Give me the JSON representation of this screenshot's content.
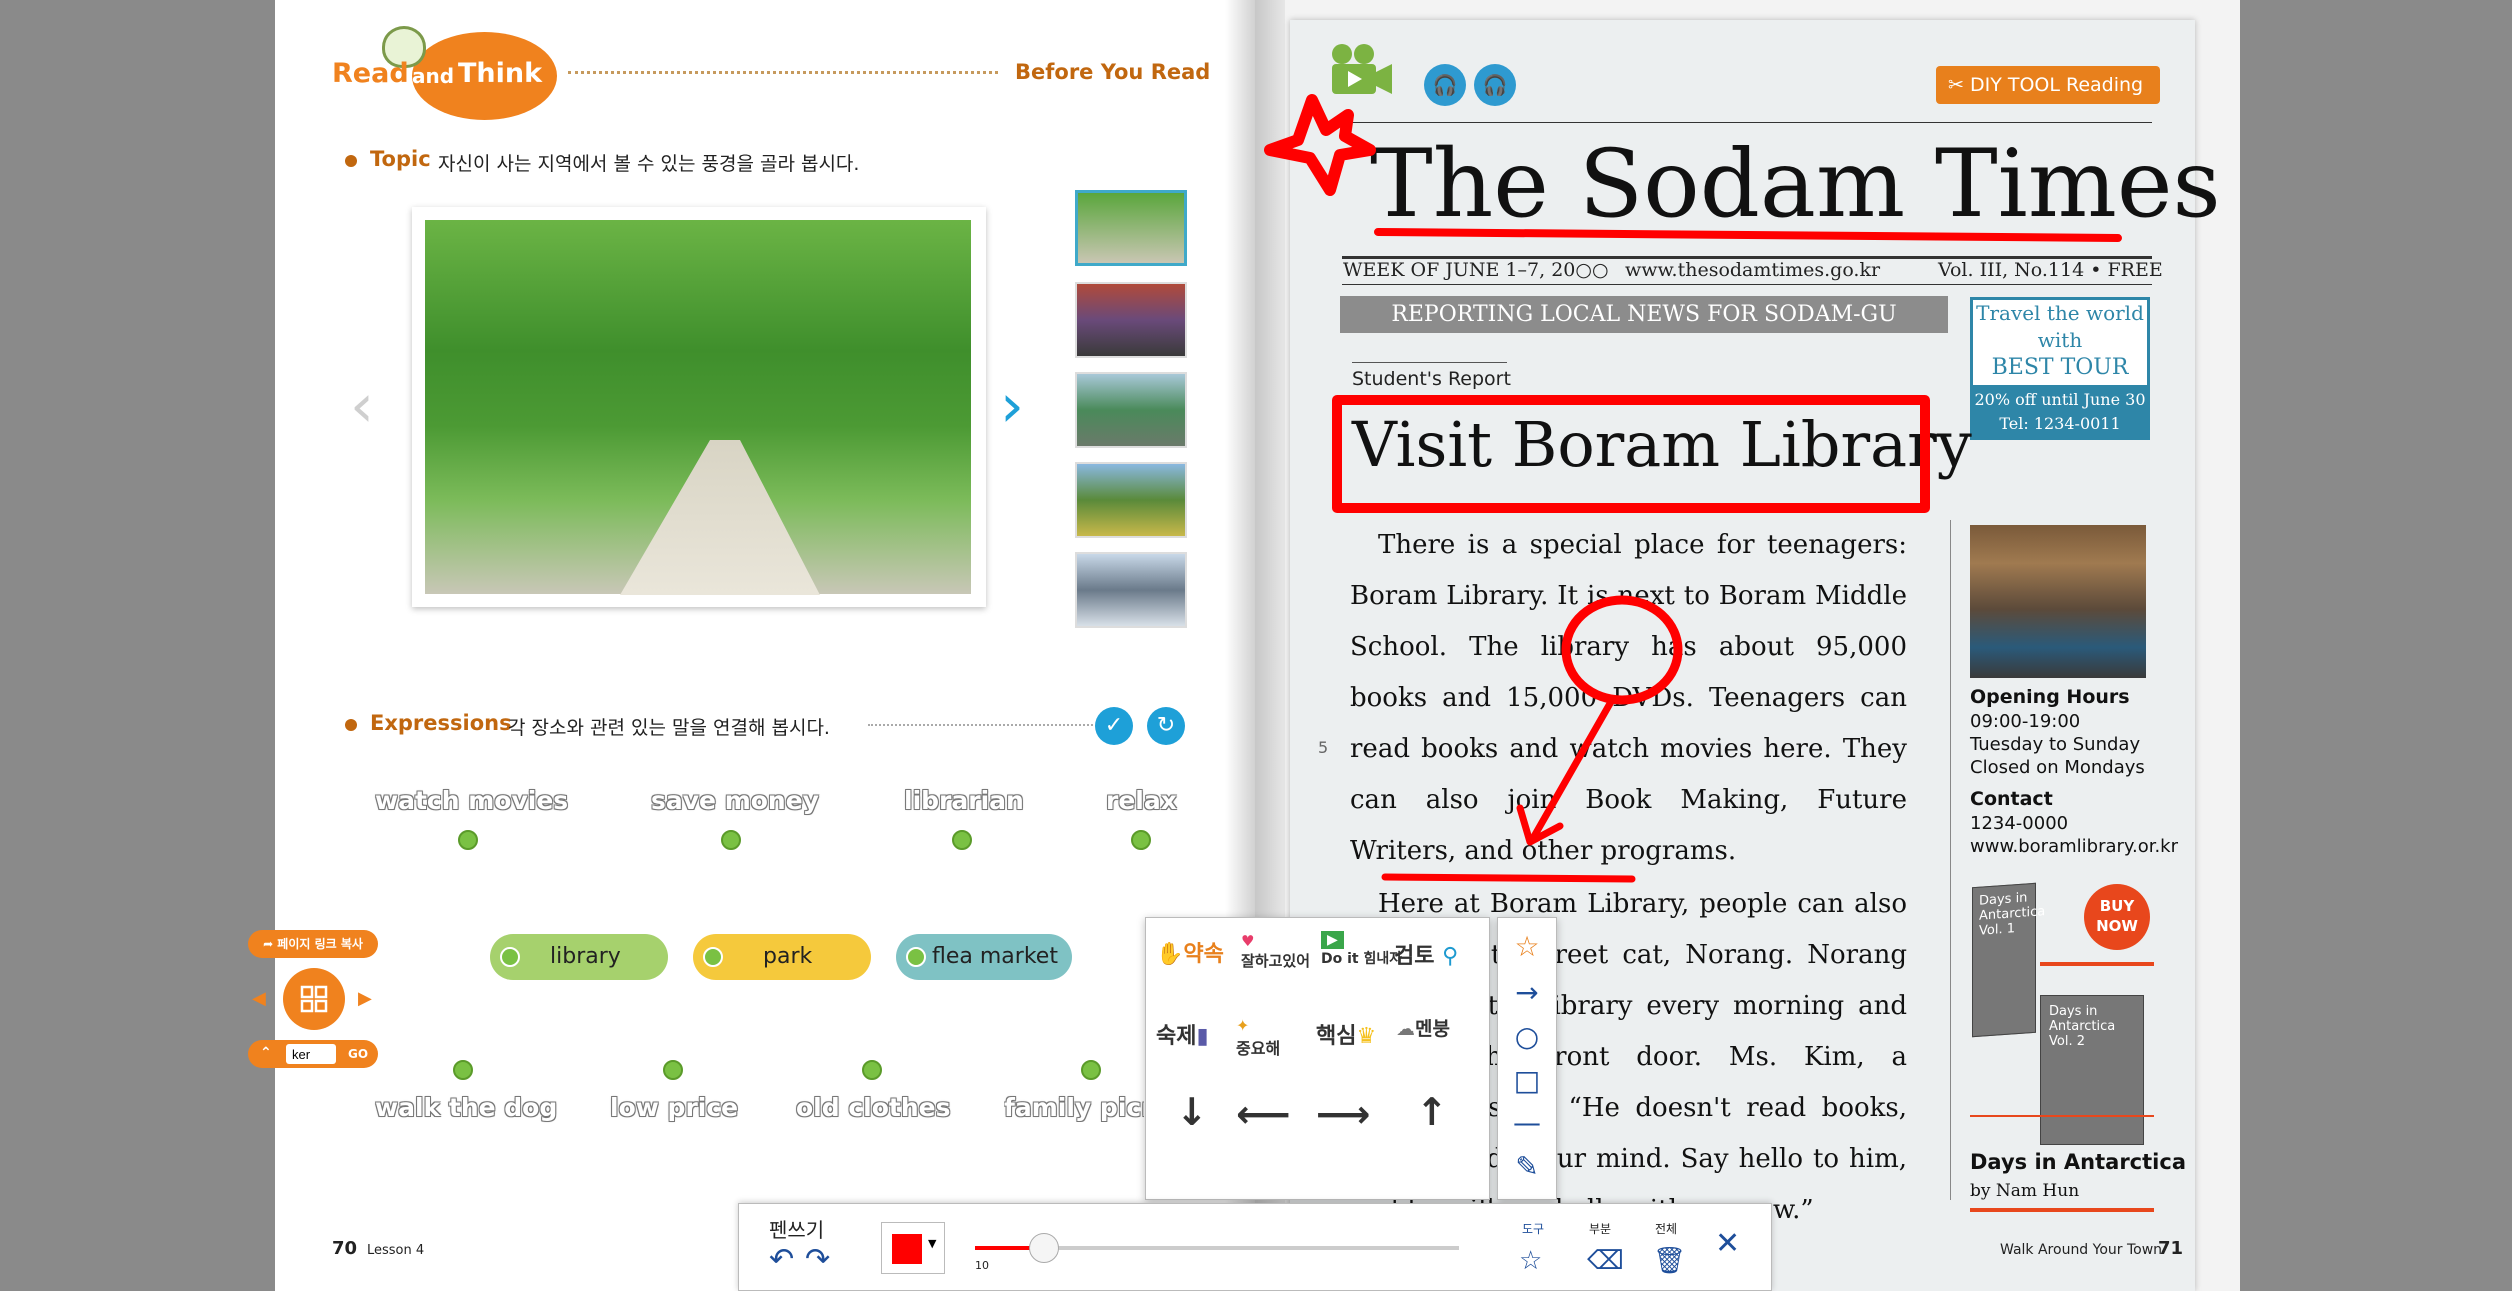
{
  "left_page": {
    "header": {
      "read": "Read",
      "and": "and",
      "think": "Think",
      "section": "Before You Read"
    },
    "topic": {
      "label": "Topic",
      "text": "자신이 사는 지역에서 볼 수 있는 풍경을 골라 봅시다."
    },
    "expressions": {
      "label": "Expressions",
      "text": "각 장소와 관련 있는 말을 연결해 봅시다.",
      "check_icon": "✓",
      "reset_icon": "↻"
    },
    "top_words": [
      "watch movies",
      "save money",
      "librarian",
      "relax"
    ],
    "places": [
      "library",
      "park",
      "flea market"
    ],
    "bottom_words": [
      "walk the dog",
      "low price",
      "old clothes",
      "family picn"
    ],
    "widget": {
      "copy_link": "페이지 링크 복사",
      "input_value": "ker",
      "go": "GO"
    },
    "footer": {
      "page": "70",
      "lesson": "Lesson 4"
    }
  },
  "newspaper": {
    "title": "The Sodam Times",
    "week": "WEEK OF JUNE 1–7, 20○○",
    "url": "www.thesodamtimes.go.kr",
    "volume": "Vol. III, No.114  •  FREE",
    "banner": "REPORTING LOCAL NEWS FOR SODAM-GU",
    "diy_tool": "DIY TOOL Reading",
    "ad": {
      "line1": "Travel the world",
      "line2": "with",
      "line3": "BEST TOUR",
      "line4": "20% off until June 30",
      "line5": "Tel: 1234-0011"
    },
    "student_report": "Student's Report",
    "headline": "Visit Boram Library",
    "paragraph1": "There is a special place for teenagers: Boram Library. It is next to Boram Middle School. The library has about 95,000 books and 15,000 DVDs. Teenagers can read books and watch movies here. They can also join Book Making, Future Writers, and other programs.",
    "paragraph2": "Here at Boram Library, people can also meet a cute street cat, Norang. Norang comes to the library every morning and sits at the front door. Ms. Kim, a librarian, says, “He doesn't read books, but he holds your mind. Say hello to him, and he will say hello with a meow.”",
    "line_number": "5",
    "side": {
      "hours_label": "Opening Hours",
      "hours_time": "09:00-19:00",
      "hours_days": "Tuesday to Sunday",
      "hours_closed": "Closed on Mondays",
      "contact_label": "Contact",
      "contact_phone": "1234-0000",
      "contact_web": "www.boramlibrary.or.kr",
      "buy_now": "BUY NOW",
      "book1": "Days in Antarctica Vol. 1",
      "book2": "Days in Antarctica Vol. 2",
      "book_title": "Days in Antarctica",
      "book_author": "by Nam Hun"
    },
    "footer": {
      "text": "Walk Around Your Town",
      "page": "71"
    }
  },
  "palette": {
    "stickers": [
      "약속",
      "잘하고있어",
      "Do it 힘내자",
      "검토",
      "숙제",
      "중요해",
      "핵심",
      "멘붕"
    ],
    "arrows": [
      "↓",
      "⟵",
      "⟶",
      "↑"
    ]
  },
  "toolbar": {
    "pen_label": "펜쓰기",
    "undo": "↶",
    "redo": "↷",
    "color": "#ff0000",
    "thickness_value": 10,
    "thickness_label": "10",
    "tool_label": "도구",
    "partial_label": "부분",
    "all_label": "전체",
    "close": "✕"
  },
  "colors": {
    "accent_orange": "#f0821e",
    "annotation_red": "#ff0000",
    "tool_blue": "#1e4e9a"
  }
}
